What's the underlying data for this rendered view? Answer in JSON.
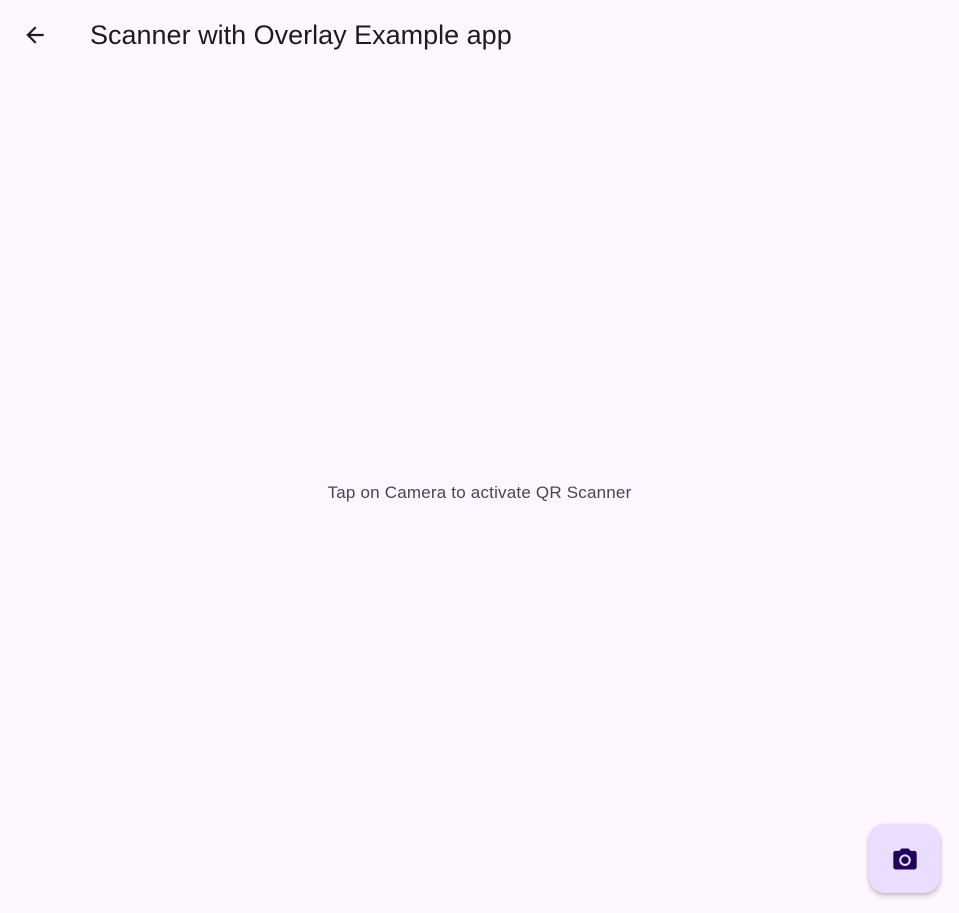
{
  "app_bar": {
    "title": "Scanner with Overlay Example app",
    "back_icon": "arrow-back-icon"
  },
  "main": {
    "hint": "Tap on Camera to activate QR Scanner"
  },
  "fab": {
    "icon": "camera-icon",
    "background": "#eaddff",
    "icon_color": "#21005d"
  },
  "theme": {
    "background": "#fef7ff",
    "text": "#1d1b20",
    "secondary_text": "#49454f"
  }
}
